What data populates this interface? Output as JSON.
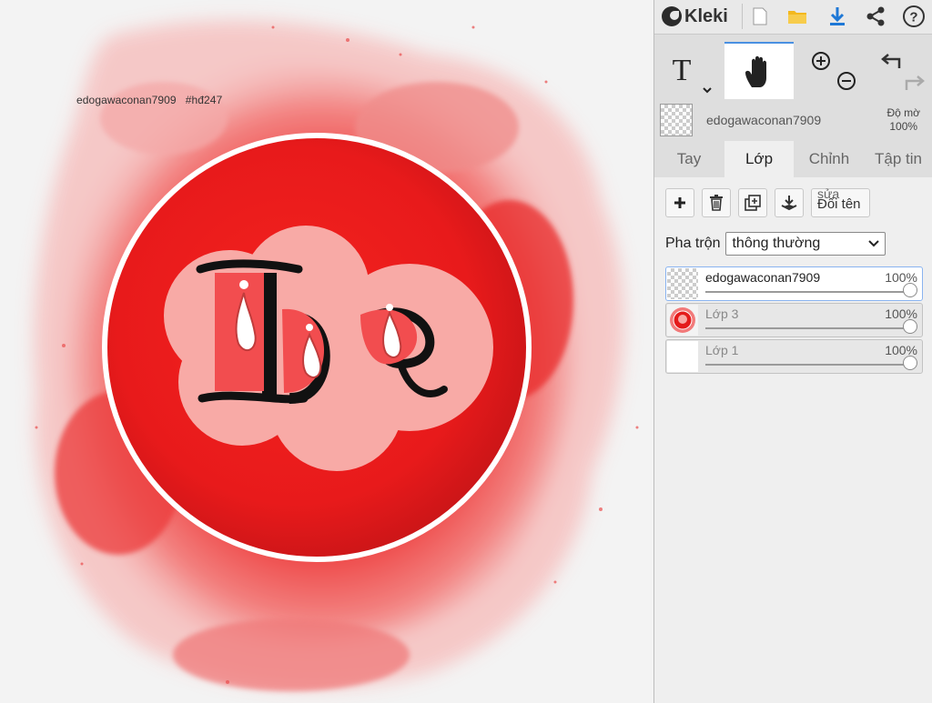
{
  "app": {
    "name": "Kleki"
  },
  "watermark": {
    "user": "edogawaconan7909",
    "tag": "#hđ247"
  },
  "artwork": {
    "text": "Doe"
  },
  "toolbar": {
    "tools": [
      "text-tool",
      "hand-tool",
      "zoom-in",
      "zoom-out",
      "undo",
      "redo"
    ]
  },
  "current_layer": {
    "name": "edogawaconan7909",
    "opacity_label": "Độ mờ",
    "opacity_value": "100%"
  },
  "tabs": [
    "Tay",
    "Lớp",
    "Chỉnh",
    "Tập tin"
  ],
  "active_tab": "Lớp",
  "layer_actions": {
    "rename_top": "sửa",
    "rename_bottom": "Đổi tên"
  },
  "blend": {
    "label": "Pha trộn",
    "value": "thông thường"
  },
  "layers": [
    {
      "name": "edogawaconan7909",
      "opacity": "100%",
      "opacity_fraction": 1.0
    },
    {
      "name": "Lớp 3",
      "opacity": "100%",
      "opacity_fraction": 1.0
    },
    {
      "name": "Lớp 1",
      "opacity": "100%",
      "opacity_fraction": 1.0
    }
  ],
  "colors": {
    "accent": "#4a90e2",
    "download": "#1e78d6",
    "folder": "#f3b81e",
    "paint_red": "#e8141c",
    "letter_pink": "#f5b3b0"
  }
}
